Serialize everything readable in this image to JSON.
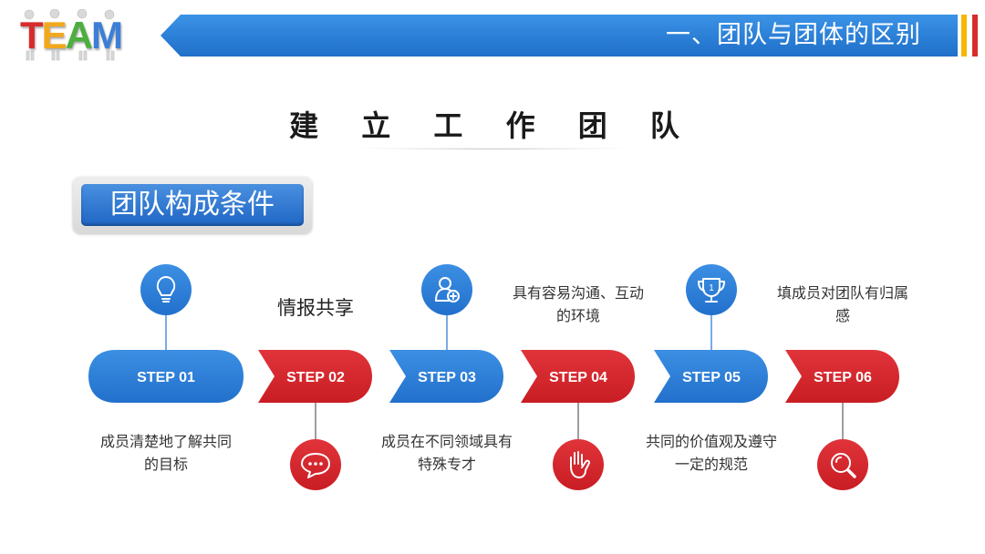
{
  "logo": {
    "text": "TEAM",
    "letters": [
      "T",
      "E",
      "A",
      "M"
    ],
    "letter_colors": [
      "#d92b2b",
      "#f2a81d",
      "#4cae3f",
      "#3d7fd6"
    ]
  },
  "header": {
    "title": "一、团队与团体的区别",
    "stripe_colors": [
      "#f5b700",
      "#d92b2b"
    ]
  },
  "section_title": "建 立 工 作 团 队",
  "subtitle": "团队构成条件",
  "colors": {
    "blue": "#2f80d9",
    "red": "#d7262c",
    "connector": "#6a6a6a"
  },
  "steps": [
    {
      "label": "STEP  01",
      "color": "blue",
      "icon": "lightbulb-icon",
      "icon_pos": "top",
      "text_lines": [
        "成员清楚地了解共同",
        "的目标"
      ],
      "text_pos": "bottom"
    },
    {
      "label": "STEP  02",
      "color": "red",
      "icon": "chat-bubble-icon",
      "icon_pos": "bottom",
      "text_lines": [
        "情报共享"
      ],
      "text_pos": "top"
    },
    {
      "label": "STEP  03",
      "color": "blue",
      "icon": "add-user-icon",
      "icon_pos": "top",
      "text_lines": [
        "成员在不同领域具有",
        "特殊专才"
      ],
      "text_pos": "bottom"
    },
    {
      "label": "STEP  04",
      "color": "red",
      "icon": "hand-icon",
      "icon_pos": "bottom",
      "text_lines": [
        "具有容易沟通、互动",
        "的环境"
      ],
      "text_pos": "top"
    },
    {
      "label": "STEP  05",
      "color": "blue",
      "icon": "trophy-icon",
      "icon_pos": "top",
      "text_lines": [
        "共同的价值观及遵守",
        "一定的规范"
      ],
      "text_pos": "bottom"
    },
    {
      "label": "STEP  06",
      "color": "red",
      "icon": "search-icon",
      "icon_pos": "bottom",
      "text_lines": [
        "填成员对团队有归属",
        "感"
      ],
      "text_pos": "top"
    }
  ]
}
